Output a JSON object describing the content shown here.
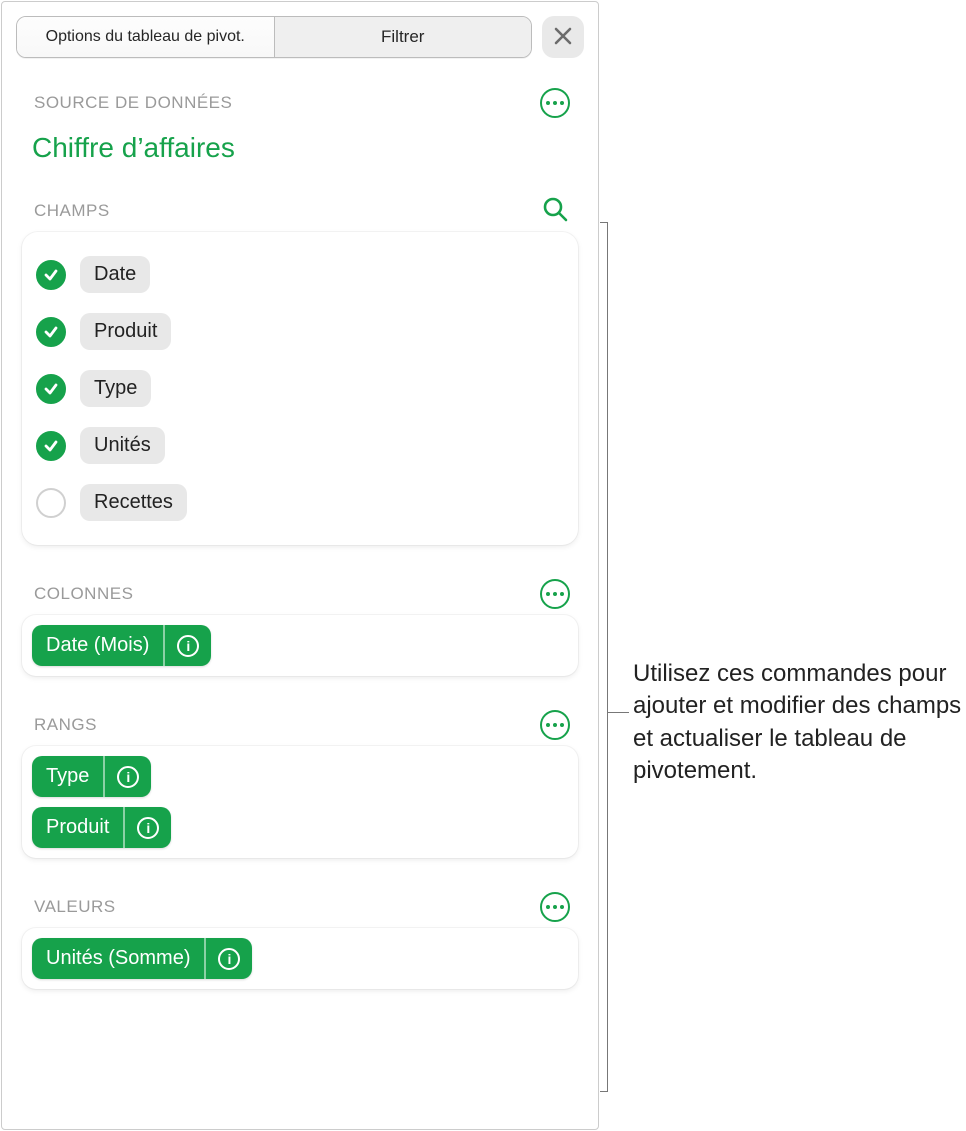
{
  "tabs": {
    "options": "Options du tableau de pivot.",
    "filter": "Filtrer"
  },
  "sections": {
    "source": "SOURCE DE DONNÉES",
    "fields": "CHAMPS",
    "columns": "COLONNES",
    "rows": "RANGS",
    "values": "VALEURS"
  },
  "source_name": "Chiffre d’affaires",
  "fields": [
    {
      "label": "Date",
      "checked": true
    },
    {
      "label": "Produit",
      "checked": true
    },
    {
      "label": "Type",
      "checked": true
    },
    {
      "label": "Unités",
      "checked": true
    },
    {
      "label": "Recettes",
      "checked": false
    }
  ],
  "columns": [
    {
      "label": "Date (Mois)"
    }
  ],
  "rows": [
    {
      "label": "Type"
    },
    {
      "label": "Produit"
    }
  ],
  "values": [
    {
      "label": "Unités (Somme)"
    }
  ],
  "callout": "Utilisez ces commandes pour ajouter et modifier des champs et actualiser le tableau de pivotement.",
  "colors": {
    "accent": "#16a24b"
  },
  "icons": {
    "close": "close-icon",
    "more": "more-icon",
    "search": "search-icon",
    "info": "info-icon",
    "check": "check-icon"
  }
}
